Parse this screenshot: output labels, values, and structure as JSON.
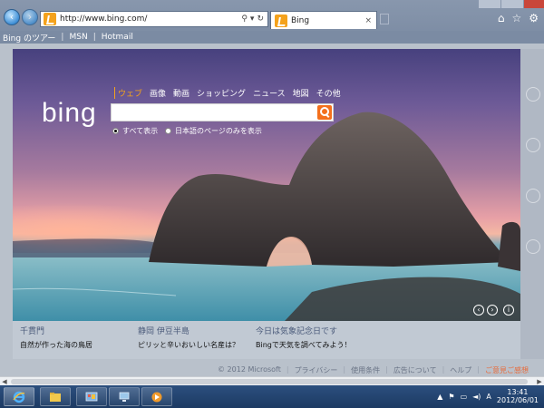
{
  "browser": {
    "url": "http://www.bing.com/",
    "tab_title": "Bing",
    "tab_close": "×",
    "back": "‹",
    "forward": "›",
    "addr_tools": [
      "⚲",
      "▾",
      "↻"
    ],
    "right_tools": [
      "⌂",
      "☆",
      "⚙"
    ]
  },
  "links_bar": {
    "items": [
      "Bing のツアー",
      "MSN",
      "Hotmail"
    ],
    "separator": "|"
  },
  "bing": {
    "logo": "bing",
    "scopes": [
      "ウェブ",
      "画像",
      "動画",
      "ショッピング",
      "ニュース",
      "地図",
      "その他"
    ],
    "search_placeholder": "",
    "radio_all": "すべて表示",
    "radio_ja": "日本語のページのみを表示",
    "hero_prev": "‹",
    "hero_next": "›",
    "hero_info": "i"
  },
  "facts": [
    {
      "title": "千貫門",
      "desc": "自然が作った海の鳥居"
    },
    {
      "title": "静岡 伊豆半島",
      "desc": "ピリッと辛いおいしい名産は？"
    },
    {
      "title": "今日は気象記念日です",
      "desc": "Bingで天気を調べてみよう！"
    }
  ],
  "footer": {
    "items": [
      "© 2012 Microsoft",
      "プライバシー",
      "使用条件",
      "広告について",
      "ヘルプ"
    ],
    "feedback": "ご意見ご感想",
    "separator": "|"
  },
  "taskbar": {
    "time": "13:41",
    "date": "2012/06/01",
    "ime": "A"
  },
  "colors": {
    "bing_orange": "#f4a21c",
    "search_button": "#f4701c",
    "taskbar": "#1c3a63"
  }
}
